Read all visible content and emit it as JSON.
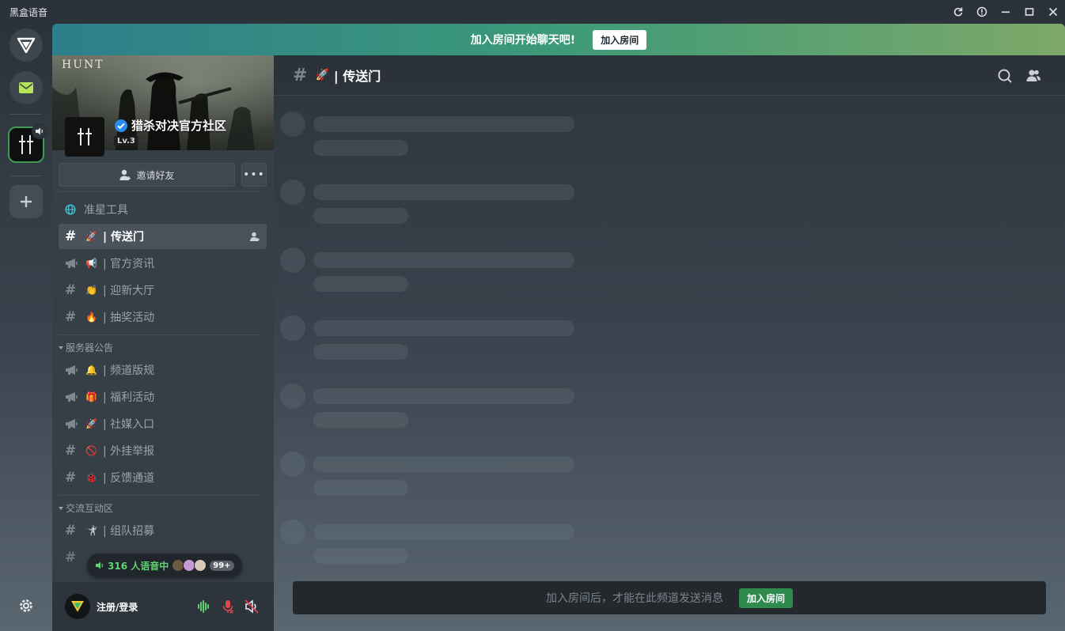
{
  "app": {
    "title": "黑盒语音"
  },
  "banner": {
    "text": "加入房间开始聊天吧!",
    "button": "加入房间"
  },
  "server": {
    "logo_text": "HUNT",
    "name": "猎杀对决官方社区",
    "level": "Lv.3",
    "invite_label": "邀请好友",
    "more_label": "•••"
  },
  "channels": {
    "tool": {
      "label": "准星工具"
    },
    "top": [
      {
        "emoji": "🚀",
        "label": "| 传送门",
        "type": "text",
        "active": true
      },
      {
        "emoji": "📢",
        "label": "| 官方资讯",
        "type": "announce"
      },
      {
        "emoji": "👏",
        "label": "| 迎新大厅",
        "type": "text"
      },
      {
        "emoji": "🔥",
        "label": "| 抽奖活动",
        "type": "text"
      }
    ],
    "cat1": {
      "label": "服务器公告"
    },
    "group1": [
      {
        "emoji": "🔔",
        "label": "| 频道版规",
        "type": "announce"
      },
      {
        "emoji": "🎁",
        "label": "| 福利活动",
        "type": "announce"
      },
      {
        "emoji": "🚀",
        "label": "| 社媒入口",
        "type": "announce"
      },
      {
        "emoji": "🚫",
        "label": "| 外挂举报",
        "type": "text"
      },
      {
        "emoji": "🐞",
        "label": "| 反馈通道",
        "type": "text"
      }
    ],
    "cat2": {
      "label": "交流互动区"
    },
    "group2": [
      {
        "emoji": "🤺",
        "label": "| 组队招募",
        "type": "text"
      }
    ]
  },
  "voice": {
    "count_text": "316 人语音中",
    "more": "99+"
  },
  "user": {
    "name": "注册/登录"
  },
  "main": {
    "channel_emoji": "🚀",
    "channel_title": "| 传送门",
    "input_hint": "加入房间后，才能在此频道发送消息",
    "join_button": "加入房间"
  },
  "colors": {
    "accent_green": "#2f8a4e",
    "banner_start": "#2c7f8b",
    "banner_end": "#7da869",
    "voice_green": "#5fd36f"
  }
}
